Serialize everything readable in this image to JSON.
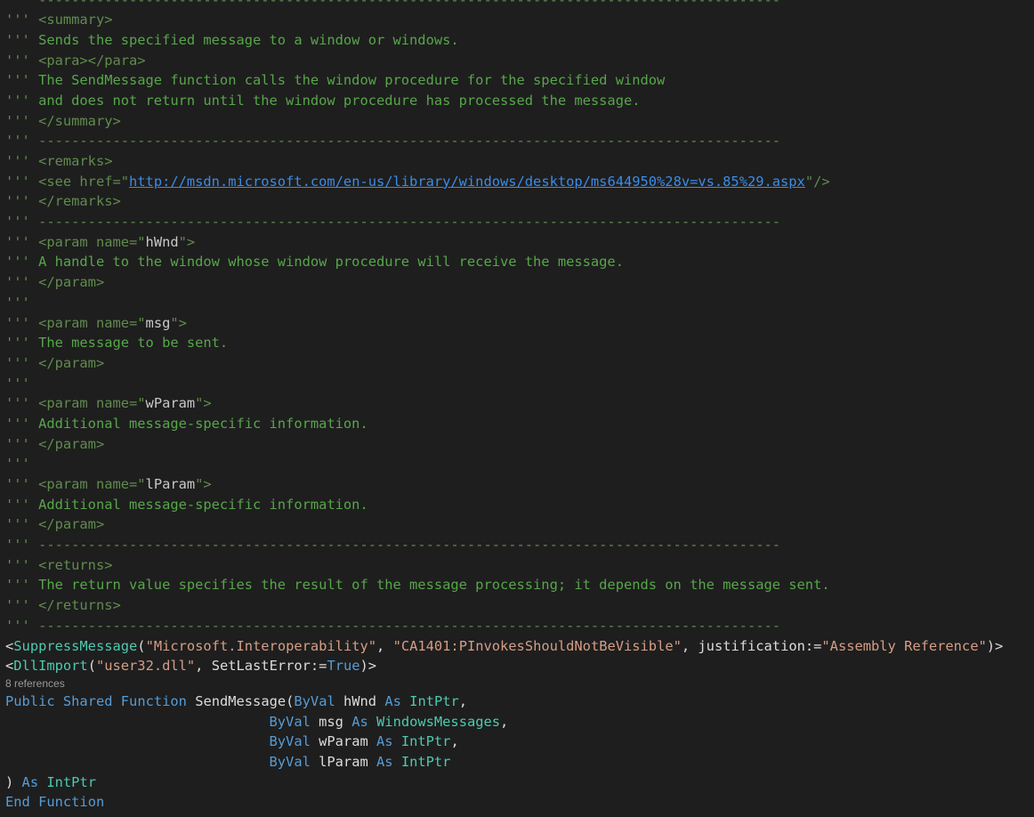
{
  "colors": {
    "background": "#1e1e1e",
    "comment_prefix": "#608b4e",
    "comment_text": "#57a64a",
    "xml_tag": "#608b4e",
    "xml_attr_value": "#c8c8c8",
    "link": "#3c8ce6",
    "keyword": "#569cd6",
    "type": "#4ec9b0",
    "string": "#d69d85",
    "plain": "#dcdcdc",
    "codelens": "#999999"
  },
  "lines": [
    {
      "name": "comment-separator-line",
      "segments": [
        {
          "t": "''' ",
          "c": "comment_prefix"
        },
        {
          "t": "------------------------------------------------------------------------------------------",
          "c": "comment_prefix"
        }
      ]
    },
    {
      "name": "comment-line",
      "segments": [
        {
          "t": "''' ",
          "c": "comment_prefix"
        },
        {
          "t": "<summary>",
          "c": "xml_tag"
        }
      ]
    },
    {
      "name": "comment-line",
      "segments": [
        {
          "t": "''' ",
          "c": "comment_prefix"
        },
        {
          "t": "Sends the specified message to a window or windows.",
          "c": "comment_text"
        }
      ]
    },
    {
      "name": "comment-line",
      "segments": [
        {
          "t": "''' ",
          "c": "comment_prefix"
        },
        {
          "t": "<para></para>",
          "c": "xml_tag"
        }
      ]
    },
    {
      "name": "comment-line",
      "segments": [
        {
          "t": "''' ",
          "c": "comment_prefix"
        },
        {
          "t": "The SendMessage function calls the window procedure for the specified window",
          "c": "comment_text"
        }
      ]
    },
    {
      "name": "comment-line",
      "segments": [
        {
          "t": "''' ",
          "c": "comment_prefix"
        },
        {
          "t": "and does not return until the window procedure has processed the message.",
          "c": "comment_text"
        }
      ]
    },
    {
      "name": "comment-line",
      "segments": [
        {
          "t": "''' ",
          "c": "comment_prefix"
        },
        {
          "t": "</summary>",
          "c": "xml_tag"
        }
      ]
    },
    {
      "name": "comment-separator-line",
      "segments": [
        {
          "t": "''' ",
          "c": "comment_prefix"
        },
        {
          "t": "------------------------------------------------------------------------------------------",
          "c": "comment_prefix"
        }
      ]
    },
    {
      "name": "comment-line",
      "segments": [
        {
          "t": "''' ",
          "c": "comment_prefix"
        },
        {
          "t": "<remarks>",
          "c": "xml_tag"
        }
      ]
    },
    {
      "name": "comment-line",
      "segments": [
        {
          "t": "''' ",
          "c": "comment_prefix"
        },
        {
          "t": "<see href=\"",
          "c": "xml_tag"
        },
        {
          "t": "http://msdn.microsoft.com/en-us/library/windows/desktop/ms644950%28v=vs.85%29.aspx",
          "c": "link",
          "link": true
        },
        {
          "t": "\"/>",
          "c": "xml_tag"
        }
      ]
    },
    {
      "name": "comment-line",
      "segments": [
        {
          "t": "''' ",
          "c": "comment_prefix"
        },
        {
          "t": "</remarks>",
          "c": "xml_tag"
        }
      ]
    },
    {
      "name": "comment-separator-line",
      "segments": [
        {
          "t": "''' ",
          "c": "comment_prefix"
        },
        {
          "t": "------------------------------------------------------------------------------------------",
          "c": "comment_prefix"
        }
      ]
    },
    {
      "name": "comment-line",
      "segments": [
        {
          "t": "''' ",
          "c": "comment_prefix"
        },
        {
          "t": "<param name=\"",
          "c": "xml_tag"
        },
        {
          "t": "hWnd",
          "c": "xml_attr_value"
        },
        {
          "t": "\">",
          "c": "xml_tag"
        }
      ]
    },
    {
      "name": "comment-line",
      "segments": [
        {
          "t": "''' ",
          "c": "comment_prefix"
        },
        {
          "t": "A handle to the window whose window procedure will receive the message.",
          "c": "comment_text"
        }
      ]
    },
    {
      "name": "comment-line",
      "segments": [
        {
          "t": "''' ",
          "c": "comment_prefix"
        },
        {
          "t": "</param>",
          "c": "xml_tag"
        }
      ]
    },
    {
      "name": "comment-line",
      "segments": [
        {
          "t": "'''",
          "c": "comment_prefix"
        }
      ]
    },
    {
      "name": "comment-line",
      "segments": [
        {
          "t": "''' ",
          "c": "comment_prefix"
        },
        {
          "t": "<param name=\"",
          "c": "xml_tag"
        },
        {
          "t": "msg",
          "c": "xml_attr_value"
        },
        {
          "t": "\">",
          "c": "xml_tag"
        }
      ]
    },
    {
      "name": "comment-line",
      "segments": [
        {
          "t": "''' ",
          "c": "comment_prefix"
        },
        {
          "t": "The message to be sent.",
          "c": "comment_text"
        }
      ]
    },
    {
      "name": "comment-line",
      "segments": [
        {
          "t": "''' ",
          "c": "comment_prefix"
        },
        {
          "t": "</param>",
          "c": "xml_tag"
        }
      ]
    },
    {
      "name": "comment-line",
      "segments": [
        {
          "t": "'''",
          "c": "comment_prefix"
        }
      ]
    },
    {
      "name": "comment-line",
      "segments": [
        {
          "t": "''' ",
          "c": "comment_prefix"
        },
        {
          "t": "<param name=\"",
          "c": "xml_tag"
        },
        {
          "t": "wParam",
          "c": "xml_attr_value"
        },
        {
          "t": "\">",
          "c": "xml_tag"
        }
      ]
    },
    {
      "name": "comment-line",
      "segments": [
        {
          "t": "''' ",
          "c": "comment_prefix"
        },
        {
          "t": "Additional message-specific information.",
          "c": "comment_text"
        }
      ]
    },
    {
      "name": "comment-line",
      "segments": [
        {
          "t": "''' ",
          "c": "comment_prefix"
        },
        {
          "t": "</param>",
          "c": "xml_tag"
        }
      ]
    },
    {
      "name": "comment-line",
      "segments": [
        {
          "t": "'''",
          "c": "comment_prefix"
        }
      ]
    },
    {
      "name": "comment-line",
      "segments": [
        {
          "t": "''' ",
          "c": "comment_prefix"
        },
        {
          "t": "<param name=\"",
          "c": "xml_tag"
        },
        {
          "t": "lParam",
          "c": "xml_attr_value"
        },
        {
          "t": "\">",
          "c": "xml_tag"
        }
      ]
    },
    {
      "name": "comment-line",
      "segments": [
        {
          "t": "''' ",
          "c": "comment_prefix"
        },
        {
          "t": "Additional message-specific information.",
          "c": "comment_text"
        }
      ]
    },
    {
      "name": "comment-line",
      "segments": [
        {
          "t": "''' ",
          "c": "comment_prefix"
        },
        {
          "t": "</param>",
          "c": "xml_tag"
        }
      ]
    },
    {
      "name": "comment-separator-line",
      "segments": [
        {
          "t": "''' ",
          "c": "comment_prefix"
        },
        {
          "t": "------------------------------------------------------------------------------------------",
          "c": "comment_prefix"
        }
      ]
    },
    {
      "name": "comment-line",
      "segments": [
        {
          "t": "''' ",
          "c": "comment_prefix"
        },
        {
          "t": "<returns>",
          "c": "xml_tag"
        }
      ]
    },
    {
      "name": "comment-line",
      "segments": [
        {
          "t": "''' ",
          "c": "comment_prefix"
        },
        {
          "t": "The return value specifies the result of the message processing; it depends on the message sent.",
          "c": "comment_text"
        }
      ]
    },
    {
      "name": "comment-line",
      "segments": [
        {
          "t": "''' ",
          "c": "comment_prefix"
        },
        {
          "t": "</returns>",
          "c": "xml_tag"
        }
      ]
    },
    {
      "name": "comment-separator-line",
      "segments": [
        {
          "t": "''' ",
          "c": "comment_prefix"
        },
        {
          "t": "------------------------------------------------------------------------------------------",
          "c": "comment_prefix"
        }
      ]
    },
    {
      "name": "attribute-line",
      "segments": [
        {
          "t": "<",
          "c": "plain"
        },
        {
          "t": "SuppressMessage",
          "c": "type"
        },
        {
          "t": "(",
          "c": "plain"
        },
        {
          "t": "\"Microsoft.Interoperability\"",
          "c": "string"
        },
        {
          "t": ", ",
          "c": "plain"
        },
        {
          "t": "\"CA1401:PInvokesShouldNotBeVisible\"",
          "c": "string"
        },
        {
          "t": ", justification:=",
          "c": "plain"
        },
        {
          "t": "\"Assembly Reference\"",
          "c": "string"
        },
        {
          "t": ")>",
          "c": "plain"
        }
      ]
    },
    {
      "name": "attribute-line",
      "segments": [
        {
          "t": "<",
          "c": "plain"
        },
        {
          "t": "DllImport",
          "c": "type"
        },
        {
          "t": "(",
          "c": "plain"
        },
        {
          "t": "\"user32.dll\"",
          "c": "string"
        },
        {
          "t": ", SetLastError:=",
          "c": "plain"
        },
        {
          "t": "True",
          "c": "keyword"
        },
        {
          "t": ")>",
          "c": "plain"
        }
      ]
    },
    {
      "name": "codelens-references",
      "lens": true,
      "segments": [
        {
          "t": "8 references",
          "c": "codelens"
        }
      ]
    },
    {
      "name": "function-signature-line",
      "segments": [
        {
          "t": "Public",
          "c": "keyword"
        },
        {
          "t": " ",
          "c": "plain"
        },
        {
          "t": "Shared",
          "c": "keyword"
        },
        {
          "t": " ",
          "c": "plain"
        },
        {
          "t": "Function",
          "c": "keyword"
        },
        {
          "t": " SendMessage(",
          "c": "plain"
        },
        {
          "t": "ByVal",
          "c": "keyword"
        },
        {
          "t": " hWnd ",
          "c": "plain"
        },
        {
          "t": "As",
          "c": "keyword"
        },
        {
          "t": " ",
          "c": "plain"
        },
        {
          "t": "IntPtr",
          "c": "type"
        },
        {
          "t": ",",
          "c": "plain"
        }
      ]
    },
    {
      "name": "parameter-line",
      "segments": [
        {
          "t": "                                ",
          "c": "plain"
        },
        {
          "t": "ByVal",
          "c": "keyword"
        },
        {
          "t": " msg ",
          "c": "plain"
        },
        {
          "t": "As",
          "c": "keyword"
        },
        {
          "t": " ",
          "c": "plain"
        },
        {
          "t": "WindowsMessages",
          "c": "type"
        },
        {
          "t": ",",
          "c": "plain"
        }
      ]
    },
    {
      "name": "parameter-line",
      "segments": [
        {
          "t": "                                ",
          "c": "plain"
        },
        {
          "t": "ByVal",
          "c": "keyword"
        },
        {
          "t": " wParam ",
          "c": "plain"
        },
        {
          "t": "As",
          "c": "keyword"
        },
        {
          "t": " ",
          "c": "plain"
        },
        {
          "t": "IntPtr",
          "c": "type"
        },
        {
          "t": ",",
          "c": "plain"
        }
      ]
    },
    {
      "name": "parameter-line",
      "segments": [
        {
          "t": "                                ",
          "c": "plain"
        },
        {
          "t": "ByVal",
          "c": "keyword"
        },
        {
          "t": " lParam ",
          "c": "plain"
        },
        {
          "t": "As",
          "c": "keyword"
        },
        {
          "t": " ",
          "c": "plain"
        },
        {
          "t": "IntPtr",
          "c": "type"
        }
      ]
    },
    {
      "name": "return-type-line",
      "segments": [
        {
          "t": ") ",
          "c": "plain"
        },
        {
          "t": "As",
          "c": "keyword"
        },
        {
          "t": " ",
          "c": "plain"
        },
        {
          "t": "IntPtr",
          "c": "type"
        }
      ]
    },
    {
      "name": "end-function-line",
      "segments": [
        {
          "t": "End",
          "c": "keyword"
        },
        {
          "t": " ",
          "c": "plain"
        },
        {
          "t": "Function",
          "c": "keyword"
        }
      ]
    }
  ]
}
